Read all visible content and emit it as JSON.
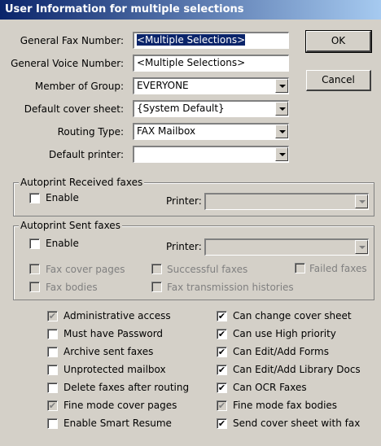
{
  "title": "User Information for multiple selections",
  "fields": {
    "fax_label": "General Fax Number:",
    "fax_value": "<Multiple Selections>",
    "voice_label": "General Voice Number:",
    "voice_value": "<Multiple Selections>",
    "group_label": "Member of Group:",
    "group_value": "EVERYONE",
    "cover_label": "Default cover sheet:",
    "cover_value": "{System Default}",
    "routing_label": "Routing Type:",
    "routing_value": "FAX Mailbox",
    "printer_label": "Default printer:",
    "printer_value": ""
  },
  "buttons": {
    "ok": "OK",
    "cancel": "Cancel"
  },
  "autoprint_received": {
    "legend": "Autoprint Received faxes",
    "enable": "Enable",
    "printer_label": "Printer:"
  },
  "autoprint_sent": {
    "legend": "Autoprint Sent faxes",
    "enable": "Enable",
    "printer_label": "Printer:",
    "fax_cover_pages": "Fax cover pages",
    "successful_faxes": "Successful faxes",
    "failed_faxes": "Failed faxes",
    "fax_bodies": "Fax bodies",
    "fax_transmission_histories": "Fax transmission histories"
  },
  "options_left": [
    {
      "label": "Administrative access",
      "state": "checked-disabled"
    },
    {
      "label": "Must have Password",
      "state": "unchecked"
    },
    {
      "label": "Archive sent faxes",
      "state": "unchecked"
    },
    {
      "label": "Unprotected mailbox",
      "state": "unchecked"
    },
    {
      "label": "Delete faxes after routing",
      "state": "unchecked"
    },
    {
      "label": "Fine mode cover pages",
      "state": "checked-disabled"
    },
    {
      "label": "Enable Smart Resume",
      "state": "unchecked"
    }
  ],
  "options_right": [
    {
      "label": "Can change cover sheet",
      "state": "checked"
    },
    {
      "label": "Can use High priority",
      "state": "checked"
    },
    {
      "label": "Can Edit/Add Forms",
      "state": "checked"
    },
    {
      "label": "Can Edit/Add Library Docs",
      "state": "checked"
    },
    {
      "label": "Can OCR Faxes",
      "state": "checked"
    },
    {
      "label": "Fine mode fax bodies",
      "state": "checked-disabled"
    },
    {
      "label": "Send cover sheet with fax",
      "state": "checked"
    }
  ]
}
